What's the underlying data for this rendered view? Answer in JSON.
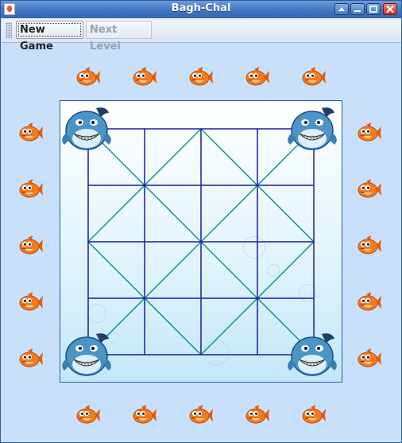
{
  "window": {
    "title": "Bagh-Chal"
  },
  "toolbar": {
    "new_game_label": "New Game",
    "next_level_label": "Next Level"
  },
  "colors": {
    "grid_blue": "#1c1c9e",
    "diagonal_teal": "#139090",
    "fish_orange": "#f47a20",
    "shark_blue": "#4a95c8"
  },
  "board": {
    "size": 5,
    "sharks": [
      {
        "row": 0,
        "col": 0
      },
      {
        "row": 0,
        "col": 4
      },
      {
        "row": 4,
        "col": 0
      },
      {
        "row": 4,
        "col": 4
      }
    ]
  },
  "reserve": {
    "goat_count": 20,
    "piece": "fish-icon"
  }
}
